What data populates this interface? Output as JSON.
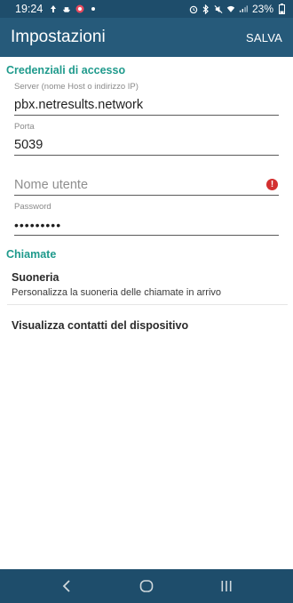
{
  "status_bar": {
    "time": "19:24",
    "battery": "23%",
    "left_icons": [
      "upload-icon",
      "ship-icon",
      "record-icon",
      "dot-icon"
    ],
    "right_icons": [
      "alarm-icon",
      "bluetooth-icon",
      "mute-icon",
      "wifi-icon",
      "signal-icon"
    ]
  },
  "app_bar": {
    "title": "Impostazioni",
    "action": "SALVA"
  },
  "credentials": {
    "header": "Credenziali di accesso",
    "server_label": "Server (nome Host o indirizzo IP)",
    "server_value": "pbx.netresults.network",
    "port_label": "Porta",
    "port_value": "5039",
    "username_placeholder": "Nome utente",
    "username_error_icon": "!",
    "password_label": "Password",
    "password_value": "•••••••••"
  },
  "calls": {
    "header": "Chiamate",
    "ringtone_title": "Suoneria",
    "ringtone_summary": "Personalizza la suoneria delle chiamate in arrivo",
    "contacts_title": "Visualizza contatti del dispositivo"
  },
  "colors": {
    "status_bar": "#1e4d6b",
    "app_bar": "#265a7a",
    "section_accent": "#1f9a8c",
    "error": "#d32f2f"
  }
}
